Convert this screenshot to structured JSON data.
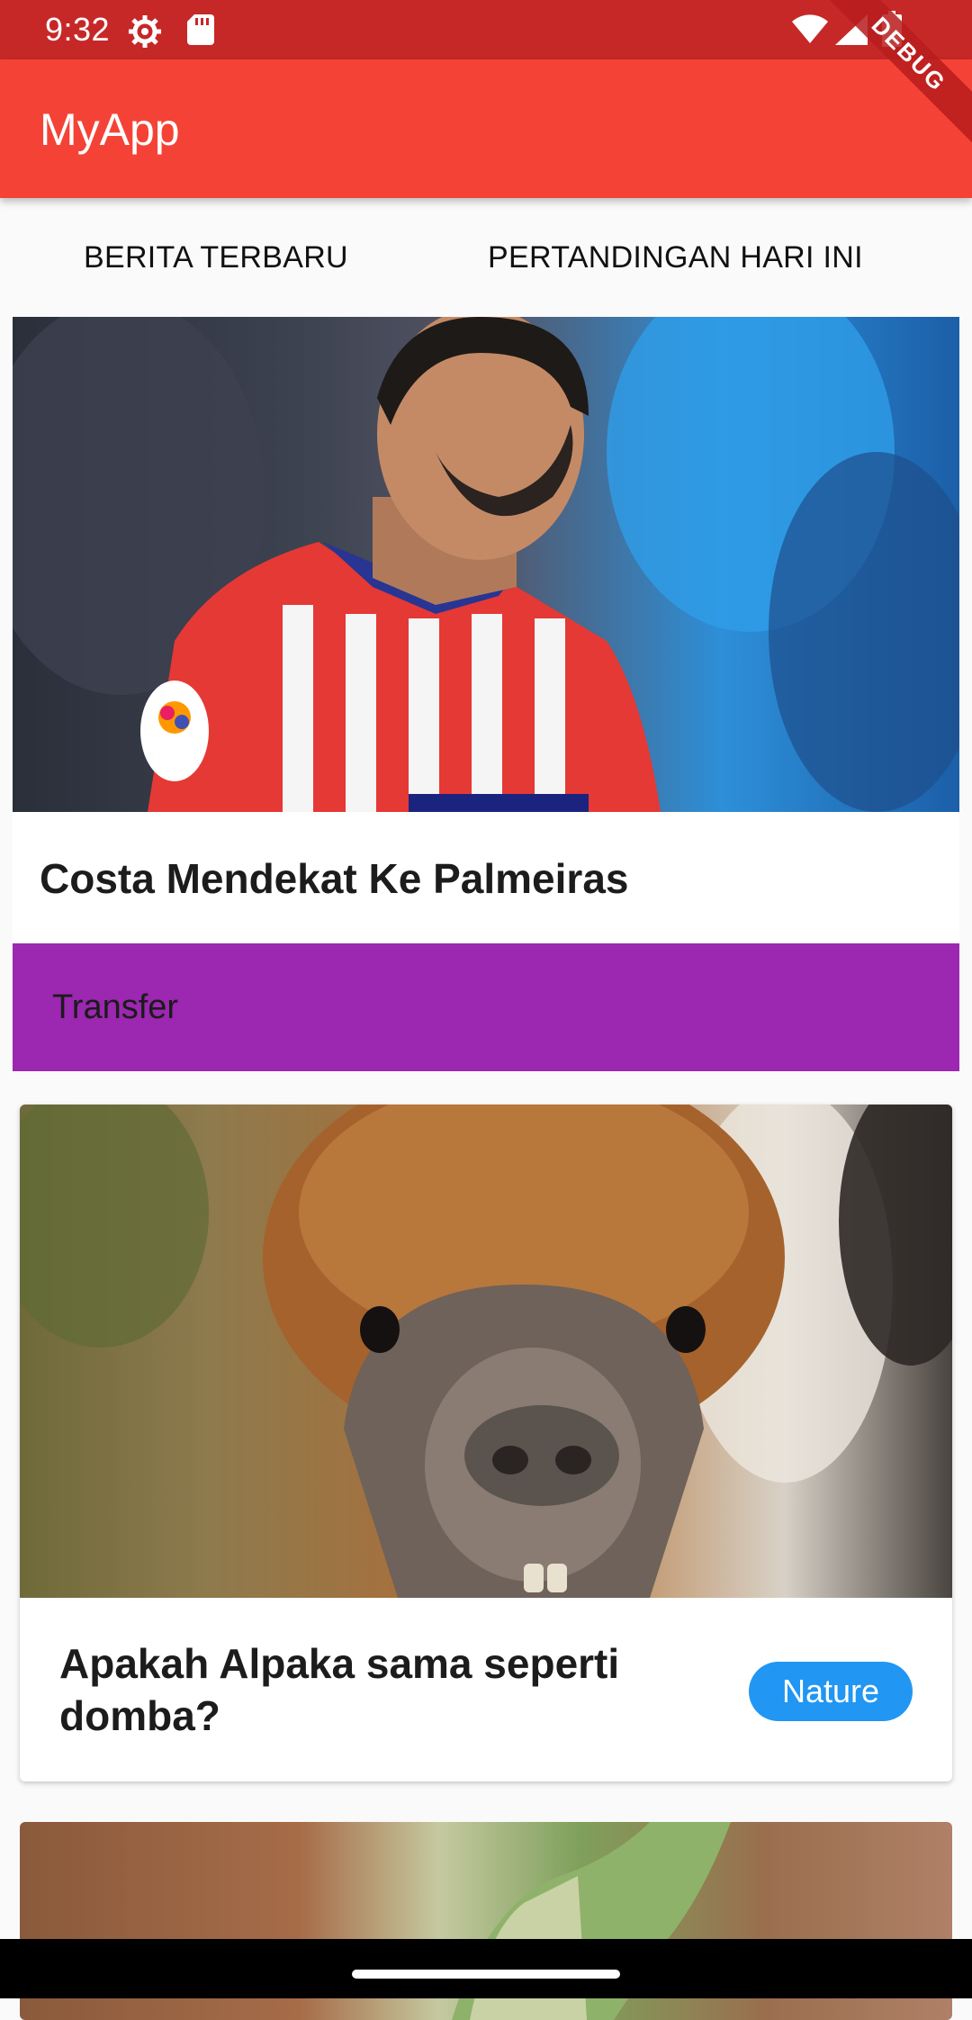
{
  "status_bar": {
    "time": "9:32",
    "icons": [
      "gear-icon",
      "sd-card-icon",
      "wifi-icon",
      "signal-icon",
      "battery-icon"
    ]
  },
  "debug_banner": "DEBUG",
  "app_bar": {
    "title": "MyApp",
    "color": "#f44336"
  },
  "tabs": [
    {
      "label": "BERITA TERBARU"
    },
    {
      "label": "PERTANDINGAN HARI INI"
    }
  ],
  "articles": [
    {
      "title": "Costa Mendekat Ke Palmeiras",
      "category": "Transfer",
      "category_color": "#9c27b0",
      "image": "footballer-photo"
    },
    {
      "title": "Apakah Alpaka sama seperti domba?",
      "category": "Nature",
      "category_color": "#2196f3",
      "image": "alpaca-photo"
    },
    {
      "image": "vegetable-photo"
    }
  ]
}
